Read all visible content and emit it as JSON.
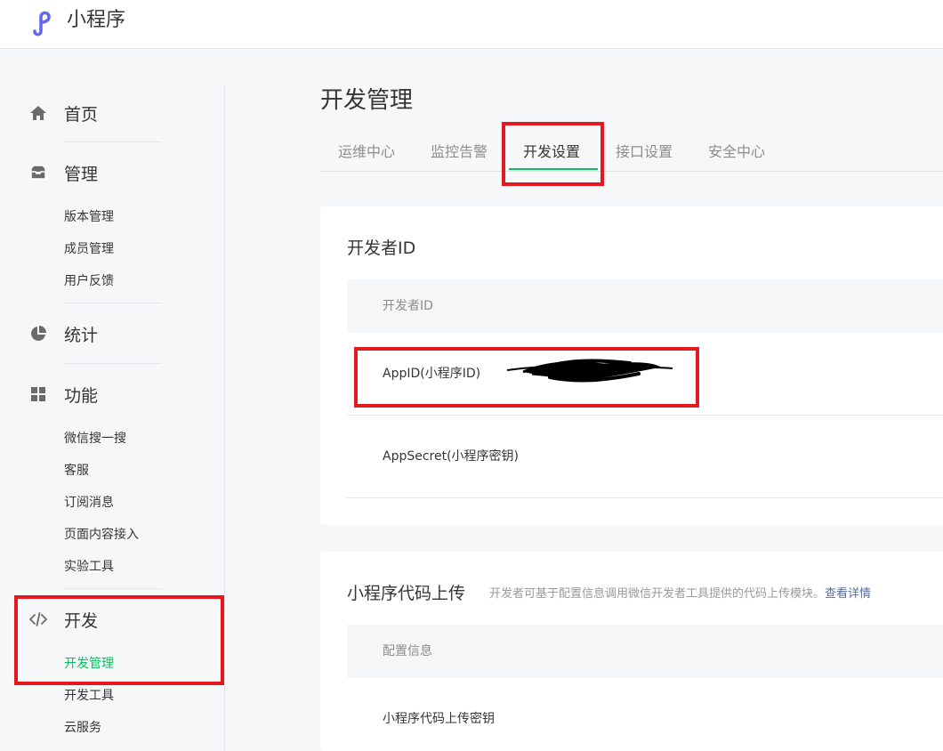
{
  "header": {
    "app_title": "小程序",
    "logo_icon": "miniprogram-logo-icon",
    "logo_color": "#6467f0"
  },
  "sidebar": {
    "groups": [
      {
        "icon": "home-icon",
        "label": "首页",
        "items": []
      },
      {
        "icon": "inbox-icon",
        "label": "管理",
        "items": [
          "版本管理",
          "成员管理",
          "用户反馈"
        ]
      },
      {
        "icon": "pie-chart-icon",
        "label": "统计",
        "items": []
      },
      {
        "icon": "grid-icon",
        "label": "功能",
        "items": [
          "微信搜一搜",
          "客服",
          "订阅消息",
          "页面内容接入",
          "实验工具"
        ]
      },
      {
        "icon": "code-icon",
        "label": "开发",
        "items": [
          "开发管理",
          "开发工具",
          "云服务"
        ],
        "active_item": "开发管理"
      }
    ]
  },
  "main": {
    "page_title": "开发管理",
    "tabs": [
      {
        "label": "运维中心",
        "active": false
      },
      {
        "label": "监控告警",
        "active": false
      },
      {
        "label": "开发设置",
        "active": true
      },
      {
        "label": "接口设置",
        "active": false
      },
      {
        "label": "安全中心",
        "active": false
      }
    ],
    "developer_card": {
      "title": "开发者ID",
      "table_header": "开发者ID",
      "rows": [
        "AppID(小程序ID)",
        "AppSecret(小程序密钥)"
      ]
    },
    "upload_card": {
      "title": "小程序代码上传",
      "description": "开发者可基于配置信息调用微信开发者工具提供的代码上传模块。",
      "link": "查看详情",
      "table_header": "配置信息",
      "rows": [
        "小程序代码上传密钥"
      ]
    }
  },
  "colors": {
    "accent_green": "#07c160",
    "highlight_red": "#e5171f",
    "link_blue": "#576b95"
  }
}
